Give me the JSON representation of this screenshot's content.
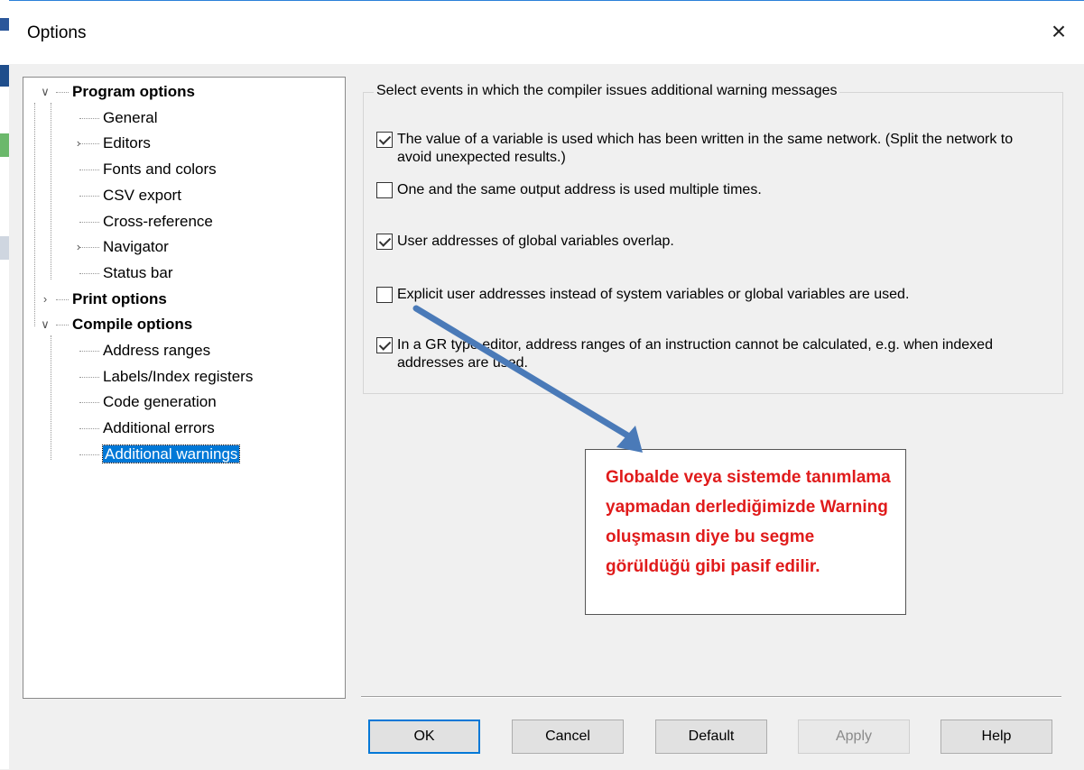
{
  "dialog": {
    "title": "Options",
    "close_label": "×"
  },
  "tree": {
    "items": [
      {
        "label": "Program options",
        "bold": true,
        "expander": "v"
      },
      {
        "label": "General"
      },
      {
        "label": "Editors",
        "expander": ">"
      },
      {
        "label": "Fonts and colors"
      },
      {
        "label": "CSV export"
      },
      {
        "label": "Cross-reference"
      },
      {
        "label": "Navigator",
        "expander": ">"
      },
      {
        "label": "Status bar"
      },
      {
        "label": "Print options",
        "bold": true,
        "expander": ">"
      },
      {
        "label": "Compile options",
        "bold": true,
        "expander": "v"
      },
      {
        "label": "Address ranges"
      },
      {
        "label": "Labels/Index registers"
      },
      {
        "label": "Code generation"
      },
      {
        "label": "Additional errors"
      },
      {
        "label": "Additional warnings",
        "selected": true
      }
    ]
  },
  "warnings": {
    "caption": "Select events in which the compiler issues additional warning messages",
    "options": [
      {
        "label": "The value of a variable is used which has been written in the same network. (Split the network to avoid unexpected results.)",
        "checked": true
      },
      {
        "label": "One and the same output address is used multiple times.",
        "checked": false
      },
      {
        "label": "User addresses of global variables overlap.",
        "checked": true
      },
      {
        "label": "Explicit user addresses instead of system variables or global variables are used.",
        "checked": false
      },
      {
        "label": "In a GR type editor, address ranges of an instruction cannot be calculated, e.g. when indexed addresses are used.",
        "checked": true
      }
    ]
  },
  "buttons": {
    "ok": "OK",
    "cancel": "Cancel",
    "default": "Default",
    "apply": "Apply",
    "help": "Help"
  },
  "annotation": {
    "text": "Globalde veya sistemde tanımlama yapmadan derlediğimizde  Warning oluşmasın diye bu segme görüldüğü gibi pasif edilir.",
    "color": "#e01b1b"
  },
  "colors": {
    "selection": "#0078d7",
    "arrow": "#4a7ab8"
  }
}
